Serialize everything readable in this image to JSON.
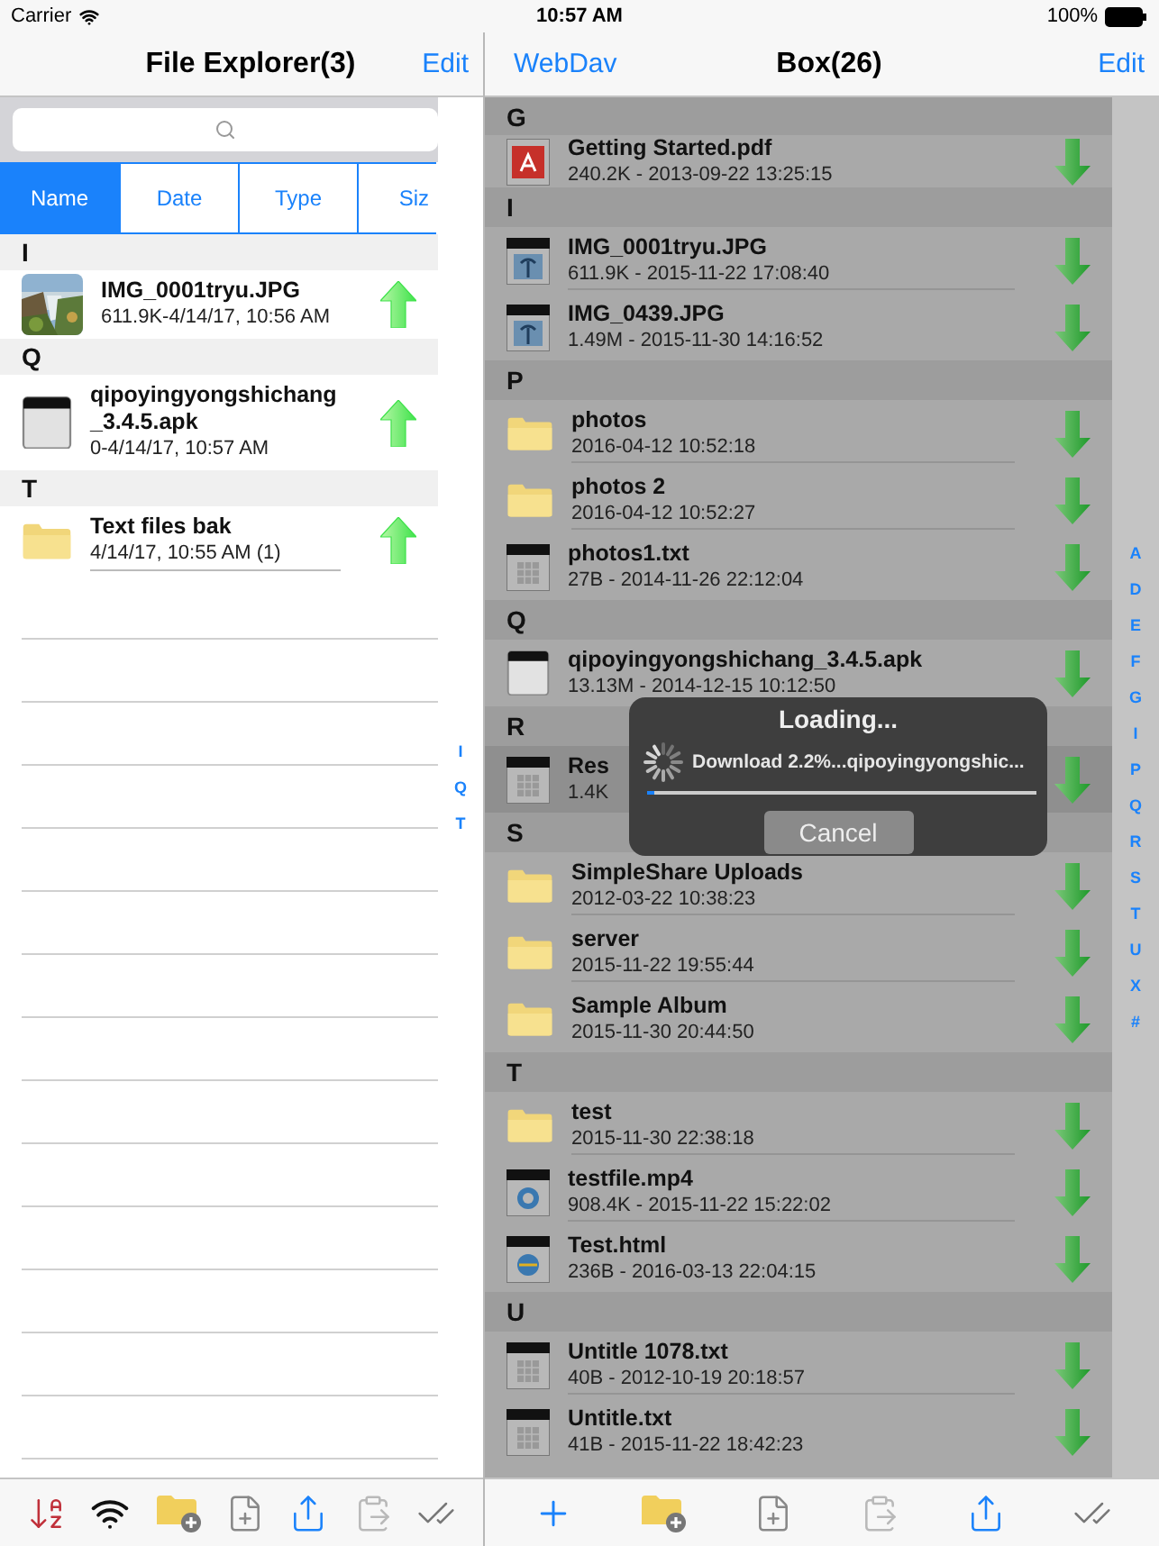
{
  "status_bar": {
    "carrier": "Carrier",
    "time": "10:57 AM",
    "battery": "100%"
  },
  "local": {
    "title": "File Explorer(3)",
    "edit": "Edit",
    "sort_tabs": [
      {
        "label": "Name",
        "selected": true
      },
      {
        "label": "Date",
        "selected": false
      },
      {
        "label": "Type",
        "selected": false
      },
      {
        "label": "Siz",
        "selected": false
      }
    ],
    "sections": [
      {
        "letter": "I",
        "items": [
          {
            "name": "IMG_0001tryu.JPG",
            "detail": "611.9K-4/14/17, 10:56 AM"
          }
        ]
      },
      {
        "letter": "Q",
        "items": [
          {
            "kind": "apk",
            "name": "qipoyingyongshichang_3.4.5.apk",
            "detail": "0-4/14/17, 10:57 AM"
          }
        ]
      },
      {
        "letter": "T",
        "items": [
          {
            "kind": "folder",
            "name": "Text files bak",
            "detail": "4/14/17, 10:55 AM (1)"
          }
        ]
      }
    ],
    "index": [
      "I",
      "Q",
      "T"
    ],
    "toolbar": [
      {
        "kind": "sort",
        "disabled": false
      },
      {
        "kind": "wifi",
        "disabled": false
      },
      {
        "kind": "new_folder",
        "disabled": false
      },
      {
        "kind": "new_file",
        "disabled": false
      },
      {
        "kind": "share",
        "disabled": false
      },
      {
        "kind": "paste",
        "disabled": true
      },
      {
        "kind": "select_all",
        "disabled": false
      }
    ]
  },
  "remote": {
    "back": "WebDav",
    "title": "Box(26)",
    "edit": "Edit",
    "sections": [
      {
        "letter": "G",
        "items": [
          {
            "kind": "pdf",
            "name": "Getting Started.pdf",
            "detail": "240.2K - 2013-09-22 13:25:15",
            "selected": false
          }
        ]
      },
      {
        "letter": "I",
        "items": [
          {
            "kind": "jpg",
            "name": "IMG_0001tryu.JPG",
            "detail": "611.9K - 2015-11-22 17:08:40",
            "selected": false
          },
          {
            "kind": "jpg",
            "name": "IMG_0439.JPG",
            "detail": "1.49M - 2015-11-30 14:16:52",
            "selected": false
          }
        ]
      },
      {
        "letter": "P",
        "items": [
          {
            "kind": "folder",
            "name": "photos",
            "detail": "2016-04-12 10:52:18",
            "selected": false
          },
          {
            "kind": "folder",
            "name": "photos 2",
            "detail": "2016-04-12 10:52:27",
            "selected": false
          },
          {
            "kind": "txt",
            "name": "photos1.txt",
            "detail": "27B - 2014-11-26 22:12:04",
            "selected": false
          }
        ]
      },
      {
        "letter": "Q",
        "items": [
          {
            "kind": "apk",
            "name": "qipoyingyongshichang_3.4.5.apk",
            "detail": "13.13M - 2014-12-15 10:12:50",
            "selected": false
          }
        ]
      },
      {
        "letter": "R",
        "items": [
          {
            "kind": "txt",
            "name": "Res",
            "detail": "1.4K",
            "selected": true
          }
        ]
      },
      {
        "letter": "S",
        "items": [
          {
            "kind": "folder",
            "name": "SimpleShare Uploads",
            "detail": "2012-03-22 10:38:23",
            "selected": false
          },
          {
            "kind": "folder",
            "name": "server",
            "detail": "2015-11-22 19:55:44",
            "selected": false
          },
          {
            "kind": "folder",
            "name": "Sample Album",
            "detail": "2015-11-30 20:44:50",
            "selected": false
          }
        ]
      },
      {
        "letter": "T",
        "items": [
          {
            "kind": "folder",
            "name": "test",
            "detail": "2015-11-30 22:38:18",
            "selected": false
          },
          {
            "kind": "mp4",
            "name": "testfile.mp4",
            "detail": "908.4K - 2015-11-22 15:22:02",
            "selected": false
          },
          {
            "kind": "html",
            "name": "Test.html",
            "detail": "236B - 2016-03-13 22:04:15",
            "selected": false
          }
        ]
      },
      {
        "letter": "U",
        "items": [
          {
            "kind": "txt",
            "name": "Untitle 1078.txt",
            "detail": "40B - 2012-10-19 20:18:57",
            "selected": false
          },
          {
            "kind": "txt",
            "name": "Untitle.txt",
            "detail": "41B - 2015-11-22 18:42:23",
            "selected": false
          }
        ]
      }
    ],
    "index": [
      "A",
      "D",
      "E",
      "F",
      "G",
      "I",
      "P",
      "Q",
      "R",
      "S",
      "T",
      "U",
      "X",
      "#"
    ],
    "loading": {
      "title": "Loading...",
      "message": "Download 2.2%...qipoyingyongshic...",
      "level": 0.02,
      "cancel": "Cancel"
    },
    "toolbar": [
      {
        "kind": "add",
        "disabled": false
      },
      {
        "kind": "new_folder",
        "disabled": false
      },
      {
        "kind": "new_file",
        "disabled": false
      },
      {
        "kind": "paste",
        "disabled": true
      },
      {
        "kind": "share",
        "disabled": false
      },
      {
        "kind": "select_all",
        "disabled": false
      }
    ]
  }
}
